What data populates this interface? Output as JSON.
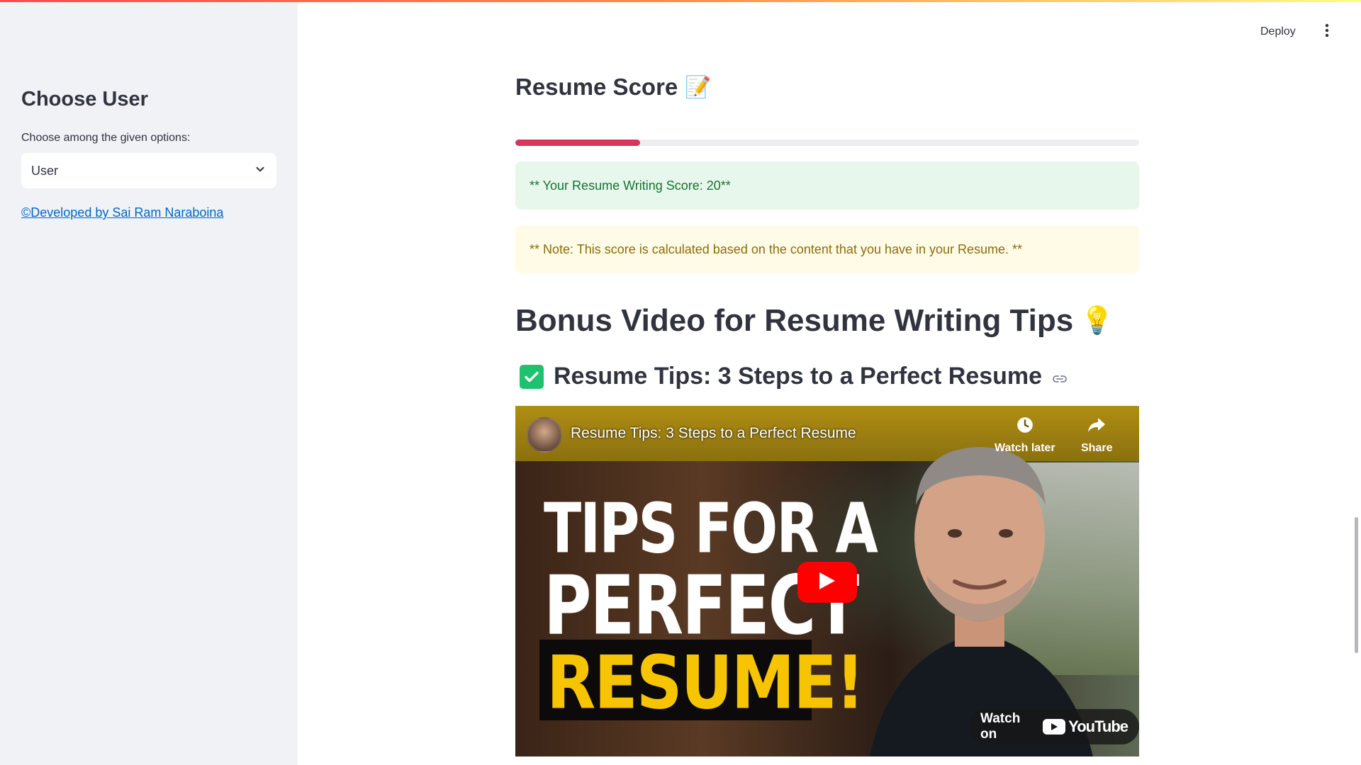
{
  "sidebar": {
    "title": "Choose User",
    "select_label": "Choose among the given options:",
    "select_value": "User",
    "credit_link": "©Developed by Sai Ram Naraboina"
  },
  "header": {
    "deploy_label": "Deploy"
  },
  "main": {
    "score_heading": "Resume Score",
    "score_heading_emoji": "📝",
    "progress_percent": 20,
    "success_message": "** Your Resume Writing Score: 20**",
    "warning_message": "** Note: This score is calculated based on the content that you have in your Resume. **",
    "bonus_heading": "Bonus Video for Resume Writing Tips",
    "bonus_heading_emoji": "💡",
    "video_heading": "Resume Tips: 3 Steps to a Perfect Resume"
  },
  "video": {
    "title": "Resume Tips: 3 Steps to a Perfect Resume",
    "watch_later_label": "Watch later",
    "share_label": "Share",
    "thumb_line1": "TIPS FOR A",
    "thumb_line2": "PERFECT",
    "thumb_line3": "RESUME!",
    "watch_on_label": "Watch on",
    "youtube_label": "YouTube"
  },
  "colors": {
    "accent": "#d9355a",
    "success_bg": "#e8f7ec",
    "success_text": "#177233",
    "warning_bg": "#fffbe6",
    "warning_text": "#8a6d0b",
    "link": "#0068c9"
  }
}
